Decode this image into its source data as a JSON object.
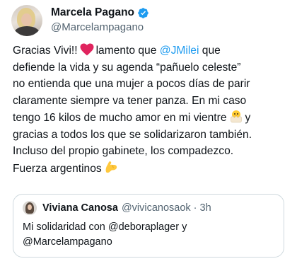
{
  "author": {
    "display_name": "Marcela Pagano",
    "handle": "@Marcelampagano",
    "verified_icon": "verified-badge-icon",
    "verified_color": "#1d9bf0"
  },
  "tweet": {
    "line1_a": "Gracias Vivi!!",
    "line1_emoji": "red-heart-icon",
    "line1_b": "lamento que",
    "line1_mention": "@JMilei",
    "line1_c": "que",
    "line2": "defiende la vida y su agenda “pañuelo celeste”",
    "line3": "no entienda que una mujer a pocos días de parir",
    "line4": "claramente siempre va tener panza. En mi caso",
    "line5_a": "tengo 16 kilos de mucho amor en mi vientre",
    "line5_emoji": "hatching-chick-icon",
    "line5_b": "y",
    "line6": "gracias a todos los que se solidarizaron también.",
    "line7": "Incluso del propio gabinete, los compadezco.",
    "line8": "Fuerza argentinos",
    "line8_emoji": "flexed-biceps-icon"
  },
  "quote": {
    "display_name": "Viviana Canosa",
    "handle": "@vivicanosaok",
    "separator": "·",
    "time": "3h",
    "text_line1": "Mi solidaridad con @deboraplager y",
    "text_line2": "@Marcelampagano"
  },
  "colors": {
    "text": "#0f1419",
    "secondary": "#536471",
    "link": "#1d9bf0",
    "border": "#cfd9de"
  }
}
